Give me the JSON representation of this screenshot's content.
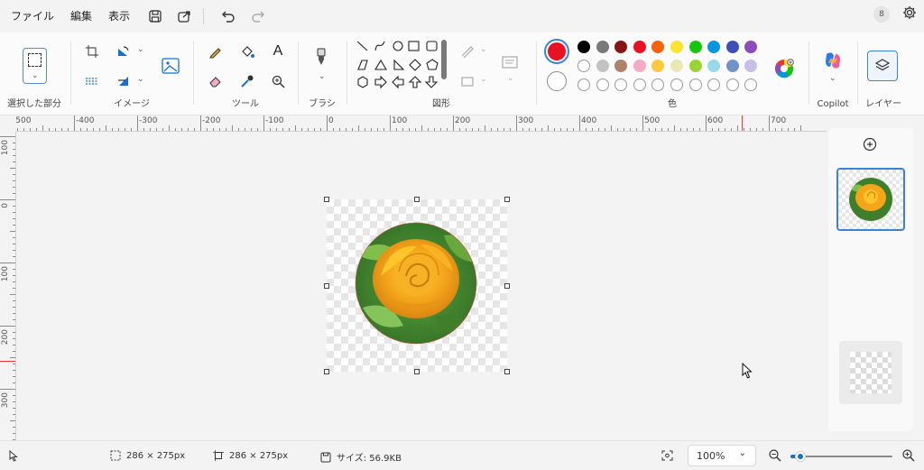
{
  "menu": {
    "file": "ファイル",
    "edit": "編集",
    "view": "表示"
  },
  "toolbar_icons": [
    "save-icon",
    "share-icon",
    "undo-icon",
    "redo-icon"
  ],
  "account": {
    "avatar_text": "8"
  },
  "ribbon": {
    "groups": {
      "selection": "選択した部分",
      "image": "イメージ",
      "tools": "ツール",
      "brush": "ブラシ",
      "shapes": "図形",
      "colors": "色",
      "copilot": "Copilot",
      "layers": "レイヤー"
    },
    "text_tool": "A"
  },
  "colors": {
    "primary": "#e81224",
    "secondary": "#ffffff",
    "palette_row1": [
      "#000000",
      "#7a7a7a",
      "#881414",
      "#e81224",
      "#f7630c",
      "#fde22f",
      "#16c60c",
      "#0a96dc",
      "#3e4fb8",
      "#8c4bb9"
    ],
    "palette_row2": [
      "#ffffff",
      "#c3c3c3",
      "#b1826b",
      "#f4abc7",
      "#ffc83d",
      "#ebe7b0",
      "#9bd434",
      "#99d9ea",
      "#7293c6",
      "#c8bfe7"
    ],
    "palette_row3_count": 10
  },
  "ruler": {
    "h_labels": [
      "-500",
      "-400",
      "-300",
      "-200",
      "-100",
      "0",
      "100",
      "200",
      "300",
      "400",
      "500",
      "600",
      "700"
    ],
    "v_labels": [
      "100",
      "0",
      "100",
      "200",
      "300"
    ]
  },
  "status": {
    "selection_size": "286 × 275px",
    "canvas_size": "286 × 275px",
    "file_size": "サイズ: 56.9KB",
    "zoom": "100%"
  },
  "zoom_slider_value_fraction": 0.1,
  "canvas": {
    "image": "yellow-rose-circle"
  }
}
